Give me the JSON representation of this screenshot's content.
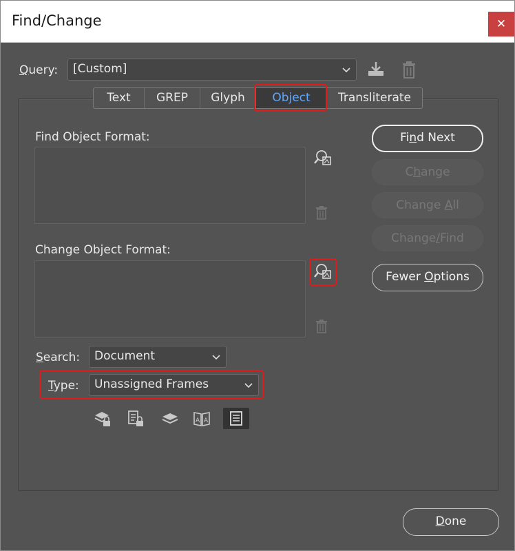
{
  "window": {
    "title": "Find/Change",
    "close_glyph": "✕"
  },
  "query": {
    "label_prefix": "Q",
    "label_rest": "uery:",
    "value": "[Custom]",
    "save_icon": "save-query-icon",
    "delete_icon": "trash-icon"
  },
  "tabs": [
    {
      "label": "Text"
    },
    {
      "label": "GREP"
    },
    {
      "label": "Glyph"
    },
    {
      "label": "Object",
      "active": true
    },
    {
      "label": "Transliterate"
    }
  ],
  "find_format": {
    "label": "Find Object Format:"
  },
  "change_format": {
    "label": "Change Object Format:"
  },
  "buttons": {
    "find_next": {
      "pre": "Fi",
      "u": "n",
      "post": "d Next"
    },
    "change": {
      "pre": "C",
      "u": "h",
      "post": "ange"
    },
    "change_all": {
      "pre": "Change ",
      "u": "A",
      "post": "ll"
    },
    "change_find": {
      "pre": "Change",
      "u": "/",
      "post": "Find"
    },
    "fewer_options": {
      "pre": "Fewer ",
      "u": "O",
      "post": "ptions"
    },
    "done": {
      "pre": "",
      "u": "D",
      "post": "one"
    }
  },
  "search": {
    "label_u": "S",
    "label_rest": "earch:",
    "value": "Document"
  },
  "type": {
    "label_u": "T",
    "label_rest": "ype:",
    "value": "Unassigned Frames"
  },
  "colors": {
    "accent": "#5aa8ff",
    "highlight": "#e11a1a",
    "dialog_bg": "#535353"
  }
}
